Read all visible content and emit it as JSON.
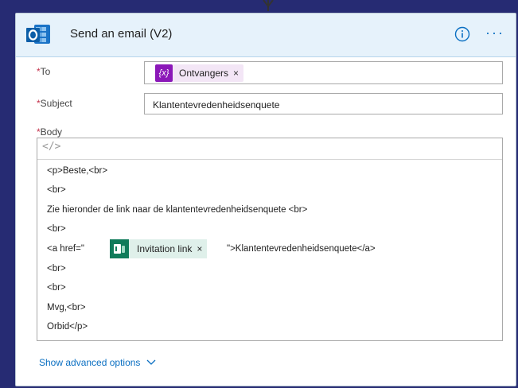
{
  "header": {
    "title": "Send an email (V2)"
  },
  "to": {
    "label": "To",
    "required_mark": "*",
    "token_icon_text": "{x}",
    "token_label": "Ontvangers",
    "token_remove": "×"
  },
  "subject": {
    "label": "Subject",
    "required_mark": "*",
    "value": "Klantentevredenheidsenquete"
  },
  "body": {
    "label": "Body",
    "required_mark": "*",
    "code_toggle": "</>",
    "lines": [
      "<p>Beste,<br>",
      "<br>",
      "Zie hieronder de link naar de klantentevredenheidsenquete <br>",
      "<br>",
      "<a href=\"",
      "<br>",
      "<br>",
      "Mvg,<br>",
      "Orbid</p>"
    ],
    "invite_token_label": "Invitation link",
    "invite_token_remove": "×",
    "after_token": "\">Klantentevredenheidsenquete</a>"
  },
  "footer": {
    "advanced_label": "Show advanced options"
  },
  "colors": {
    "background": "#262b73",
    "header_bg": "#e6f2fb",
    "accent": "#0a6fc2",
    "token_purple": "#8b18b8",
    "token_green": "#0f7b5a",
    "required": "#c4314b"
  },
  "icons": {
    "app": "outlook-icon",
    "info": "info-icon",
    "more": "more-icon",
    "variable": "variable-icon",
    "forms": "forms-icon",
    "chevron": "chevron-down-icon"
  }
}
